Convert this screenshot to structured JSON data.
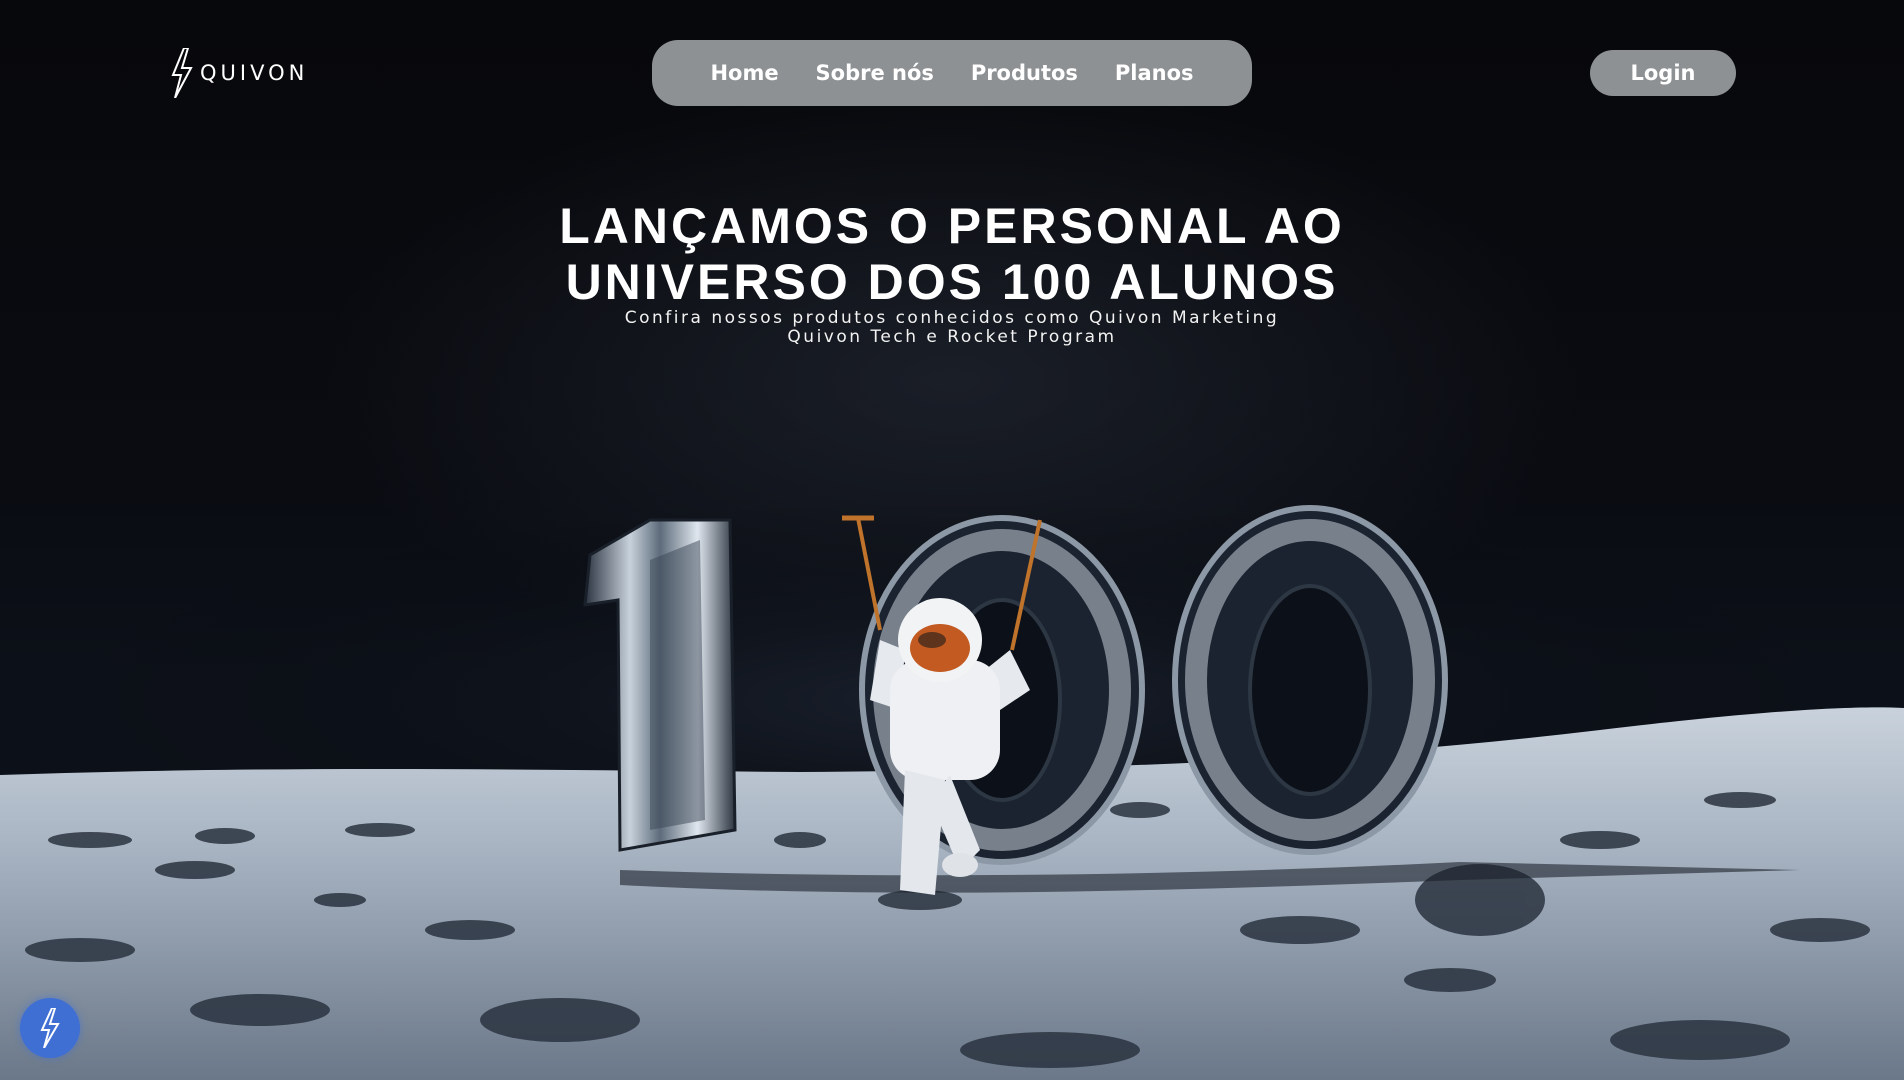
{
  "header": {
    "brand_name": "QUIVON",
    "logo_icon": "lightning-bolt-icon",
    "nav": [
      {
        "label": "Home"
      },
      {
        "label": "Sobre nós"
      },
      {
        "label": "Produtos"
      },
      {
        "label": "Planos"
      }
    ],
    "login_label": "Login"
  },
  "hero": {
    "title_line1": "LANÇAMOS O PERSONAL AO",
    "title_line2": "UNIVERSO DOS 100 ALUNOS",
    "subtitle_line1": "Confira nossos produtos conhecidos como Quivon Marketing",
    "subtitle_line2": "Quivon Tech e Rocket Program"
  },
  "floating_button": {
    "icon": "lightning-bolt-icon"
  },
  "colors": {
    "background": "#05070b",
    "nav_pill": "#8e9194",
    "fab": "#3f6fd3",
    "text": "#ffffff"
  }
}
